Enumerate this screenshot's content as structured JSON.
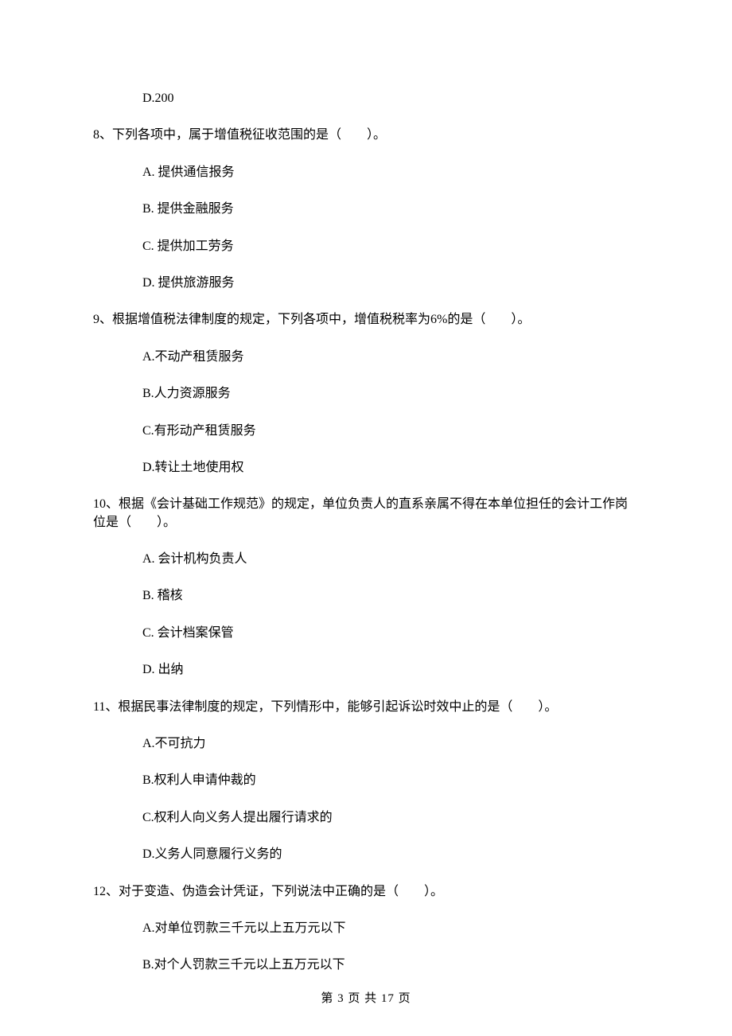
{
  "q7": {
    "opt_d": "D.200"
  },
  "q8": {
    "stem": "8、下列各项中，属于增值税征收范围的是（　　）。",
    "a": "A. 提供通信报务",
    "b": "B. 提供金融服务",
    "c": "C. 提供加工劳务",
    "d": "D. 提供旅游服务"
  },
  "q9": {
    "stem": "9、根据增值税法律制度的规定，下列各项中，增值税税率为6%的是（　　）。",
    "a": "A.不动产租赁服务",
    "b": "B.人力资源服务",
    "c": "C.有形动产租赁服务",
    "d": "D.转让土地使用权"
  },
  "q10": {
    "stem": "10、根据《会计基础工作规范》的规定，单位负责人的直系亲属不得在本单位担任的会计工作岗位是（　　）。",
    "a": "A. 会计机构负责人",
    "b": "B. 稽核",
    "c": "C. 会计档案保管",
    "d": "D. 出纳"
  },
  "q11": {
    "stem": "11、根据民事法律制度的规定，下列情形中，能够引起诉讼时效中止的是（　　）。",
    "a": "A.不可抗力",
    "b": "B.权利人申请仲裁的",
    "c": "C.权利人向义务人提出履行请求的",
    "d": "D.义务人同意履行义务的"
  },
  "q12": {
    "stem": "12、对于变造、伪造会计凭证，下列说法中正确的是（　　）。",
    "a": "A.对单位罚款三千元以上五万元以下",
    "b": "B.对个人罚款三千元以上五万元以下"
  },
  "footer": "第 3 页 共 17 页"
}
